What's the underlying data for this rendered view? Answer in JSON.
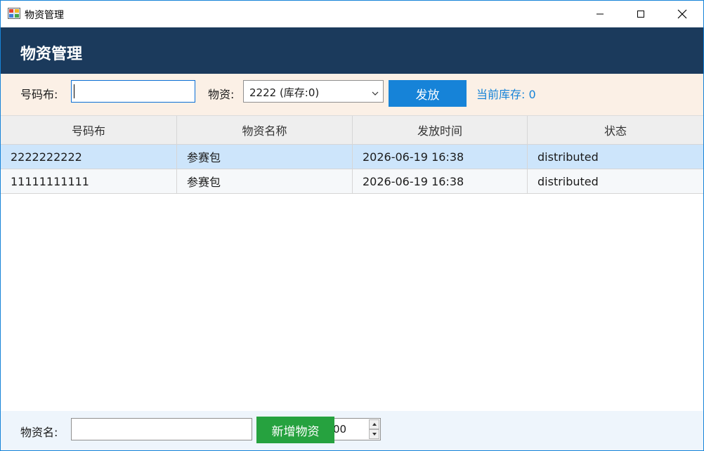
{
  "window": {
    "title": "物资管理",
    "icon": "app-window-icon",
    "controls": [
      "minimize-icon",
      "maximize-icon",
      "close-icon"
    ]
  },
  "header": {
    "title": "物资管理"
  },
  "toolbar": {
    "bib_label": "号码布:",
    "bib_value": "",
    "material_label": "物资:",
    "material_selected": "2222 (库存:0)",
    "issue_button": "发放",
    "current_stock": "当前库存: 0"
  },
  "table": {
    "columns": [
      "号码布",
      "物资名称",
      "发放时间",
      "状态"
    ],
    "rows": [
      [
        "2222222222",
        "参赛包",
        "2026-06-19 16:38",
        "distributed"
      ],
      [
        "11111111111",
        "参赛包",
        "2026-06-19 16:38",
        "distributed"
      ]
    ],
    "selected_row": 0
  },
  "footer": {
    "name_label": "物资名:",
    "name_value": "",
    "add_button": "新增物资",
    "quantity_value": "00"
  },
  "colors": {
    "banner": "#1b3a5c",
    "accent_blue": "#1683d8",
    "add_green": "#26a23f",
    "toolbar_bg": "#fbf0e6",
    "selected_row": "#cde5fb"
  }
}
